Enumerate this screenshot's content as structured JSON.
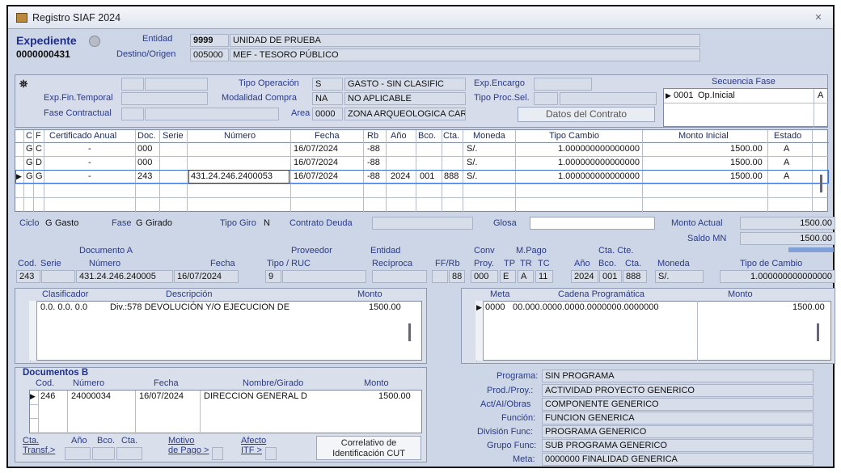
{
  "window": {
    "title": "Registro SIAF 2024",
    "close_glyph": "✕"
  },
  "expediente": {
    "label": "Expediente",
    "number": "0000000431",
    "entidad_label": "Entidad",
    "entidad_code": "9999",
    "entidad_name": "UNIDAD DE PRUEBA",
    "destino_label": "Destino/Origen",
    "destino_code": "005000",
    "destino_name": "MEF - TESORO PÚBLICO"
  },
  "header": {
    "binoculars_icon": "binoculars-icon",
    "tipo_operacion_label": "Tipo Operación",
    "tipo_operacion_code": "S",
    "tipo_operacion_name": "GASTO - SIN CLASIFIC",
    "exp_encargo_label": "Exp.Encargo",
    "exp_fin_temporal_label": "Exp.Fin.Temporal",
    "modalidad_compra_label": "Modalidad Compra",
    "modalidad_compra_code": "NA",
    "modalidad_compra_name": "NO APLICABLE",
    "tipo_proc_sel_label": "Tipo Proc.Sel.",
    "fase_contractual_label": "Fase Contractual",
    "area_label": "Area",
    "area_code": "0000",
    "area_name": "ZONA ARQUEOLOGICA CARAL",
    "datos_contrato_button": "Datos del Contrato"
  },
  "secuencia": {
    "title": "Secuencia Fase",
    "row_marker": "▶",
    "code": "0001",
    "name": "Op.Inicial",
    "flag": "A"
  },
  "main_grid": {
    "headers": [
      "C",
      "F",
      "Certificado Anual",
      "Doc.",
      "Serie",
      "Número",
      "Fecha",
      "Rb",
      "Año",
      "Bco.",
      "Cta.",
      "Moneda",
      "Tipo Cambio",
      "Monto Inicial",
      "Estado"
    ],
    "rows": [
      {
        "marker": "",
        "c": "G",
        "f": "C",
        "cert": "-",
        "doc": "000",
        "serie": "",
        "numero": "",
        "fecha": "16/07/2024",
        "rb": "-88",
        "anio": "",
        "bco": "",
        "cta": "",
        "moneda": "S/.",
        "tc": "1.000000000000000",
        "monto": "1500.00",
        "estado": "A"
      },
      {
        "marker": "",
        "c": "G",
        "f": "D",
        "cert": "-",
        "doc": "000",
        "serie": "",
        "numero": "",
        "fecha": "16/07/2024",
        "rb": "-88",
        "anio": "",
        "bco": "",
        "cta": "",
        "moneda": "S/.",
        "tc": "1.000000000000000",
        "monto": "1500.00",
        "estado": "A"
      },
      {
        "marker": "▶",
        "c": "G",
        "f": "G",
        "cert": "-",
        "doc": "243",
        "serie": "",
        "numero": "431.24.246.2400053",
        "fecha": "16/07/2024",
        "rb": "-88",
        "anio": "2024",
        "bco": "001",
        "cta": "888",
        "moneda": "S/.",
        "tc": "1.000000000000000",
        "monto": "1500.00",
        "estado": "A"
      }
    ]
  },
  "status": {
    "ciclo_label": "Ciclo",
    "ciclo_code": "G",
    "ciclo_name": "Gasto",
    "fase_label": "Fase",
    "fase_code": "G",
    "fase_name": "Girado",
    "tipo_giro_label": "Tipo Giro",
    "tipo_giro_value": "N",
    "contrato_deuda_label": "Contrato Deuda",
    "glosa_label": "Glosa",
    "monto_actual_label": "Monto Actual",
    "monto_actual_value": "1500.00",
    "saldo_mn_label": "Saldo MN",
    "saldo_mn_value": "1500.00"
  },
  "documento_a": {
    "group_label": "Documento A",
    "proveedor_label": "Proveedor",
    "entidad_label": "Entidad",
    "conv_label": "Conv",
    "mpago_label": "M.Pago",
    "ctacte_label": "Cta. Cte.",
    "cols": {
      "cod": "Cod.",
      "serie": "Serie",
      "numero": "Número",
      "fecha": "Fecha",
      "tipo_ruc": "Tipo / RUC",
      "reciproca": "Recíproca",
      "ffrb": "FF/Rb",
      "proy": "Proy.",
      "tp": "TP",
      "tr": "TR",
      "tc": "TC",
      "anio": "Año",
      "bco": "Bco.",
      "cta": "Cta.",
      "moneda": "Moneda",
      "tipo_cambio": "Tipo de Cambio"
    },
    "values": {
      "cod": "243",
      "serie": "",
      "numero": "431.24.246.240005",
      "fecha": "16/07/2024",
      "tipo": "9",
      "ruc": "",
      "reciproca": "",
      "ff": "",
      "rb": "88",
      "proy": "000",
      "tp": "E",
      "tr": "A",
      "tc": "11",
      "anio": "2024",
      "bco": "001",
      "cta": "888",
      "moneda": "S/.",
      "tipo_cambio": "1.000000000000000"
    }
  },
  "clasificador": {
    "headers": [
      "Clasificador",
      "Descripción",
      "Monto"
    ],
    "row": {
      "code": "0.0. 0.0. 0.0",
      "desc": "Div.:578 DEVOLUCIÓN Y/O EJECUCION DE",
      "monto": "1500.00"
    }
  },
  "meta": {
    "headers": [
      "Meta",
      "Cadena Programática",
      "Monto"
    ],
    "row": {
      "marker": "▶",
      "meta": "0000",
      "cadena": "00.000.0000.0000.0000000.0000000",
      "monto": "1500.00"
    }
  },
  "documentos_b": {
    "title": "Documentos B",
    "headers": [
      "Cod.",
      "Número",
      "Fecha",
      "Nombre/Girado",
      "Monto"
    ],
    "row": {
      "marker": "▶",
      "cod": "246",
      "numero": "24000034",
      "fecha": "16/07/2024",
      "nombre": "DIRECCION GENERAL D",
      "monto": "1500.00"
    }
  },
  "footer": {
    "cta_transf_1": "Cta.",
    "cta_transf_2": "Transf.>",
    "anio": "Año",
    "bco": "Bco.",
    "cta": "Cta.",
    "motivo_1": "Motivo",
    "motivo_2": "de Pago >",
    "afecto_1": "Afecto",
    "afecto_2": "ITF >",
    "cut_1": "Correlativo de",
    "cut_2": "Identificación CUT"
  },
  "programa": {
    "programa_label": "Programa:",
    "programa_value": "SIN PROGRAMA",
    "prod_label": "Prod./Proy.:",
    "prod_value": "ACTIVIDAD PROYECTO GENERICO",
    "act_label": "Act/AI/Obras",
    "act_value": "COMPONENTE GENERICO",
    "funcion_label": "Función:",
    "funcion_value": "FUNCION GENERICA",
    "division_label": "División Func:",
    "division_value": "PROGRAMA GENERICO",
    "grupo_label": "Grupo Func:",
    "grupo_value": "SUB PROGRAMA GENERICO",
    "meta_label": "Meta:",
    "meta_value": "0000000  FINALIDAD GENERICA"
  }
}
